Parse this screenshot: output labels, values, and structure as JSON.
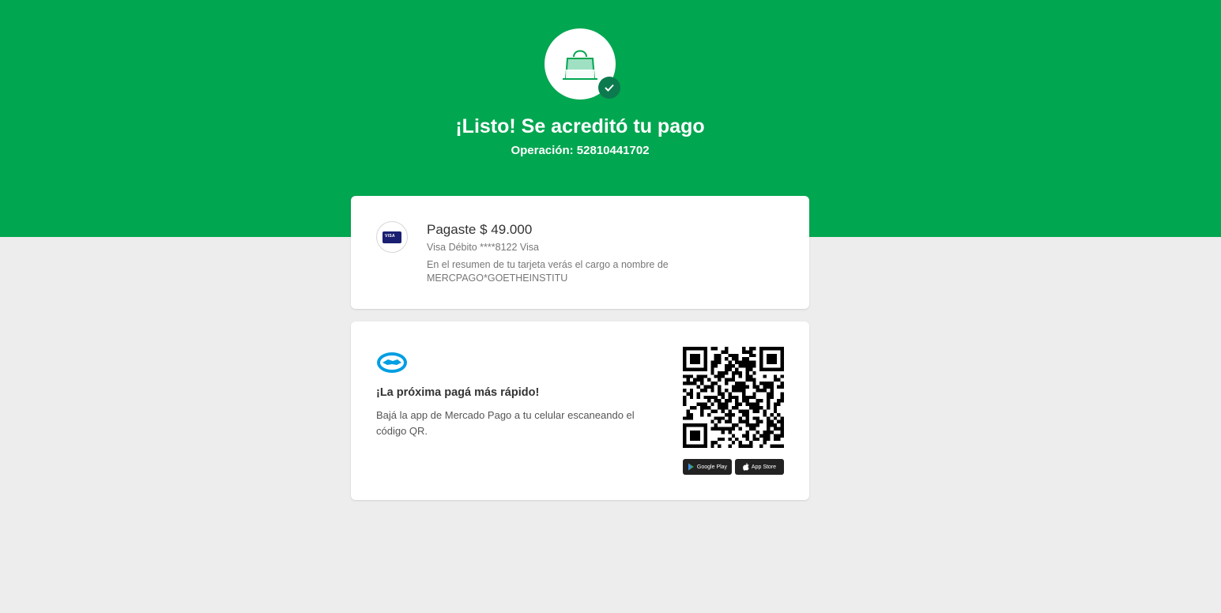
{
  "header": {
    "title": "¡Listo! Se acreditó tu pago",
    "operation": "Operación: 52810441702",
    "icons": [
      "shopping-bag-icon",
      "check-icon"
    ]
  },
  "payment": {
    "amount_text": "Pagaste $ 49.000",
    "card_text": "Visa Débito ****8122 Visa",
    "statement_note": "En el resumen de tu tarjeta verás el cargo a nombre de MERCPAGO*GOETHEINSTITU",
    "card_icon_text": "VISA"
  },
  "app_promo": {
    "title": "¡La próxima pagá más rápido!",
    "text": "Bajá la app de Mercado Pago a tu celular escaneando el código QR.",
    "google_play_label": "Google Play",
    "app_store_label": "App Store"
  },
  "colors": {
    "brand_green": "#00a650",
    "check_badge": "#0c7a4e",
    "background": "#ededed"
  }
}
